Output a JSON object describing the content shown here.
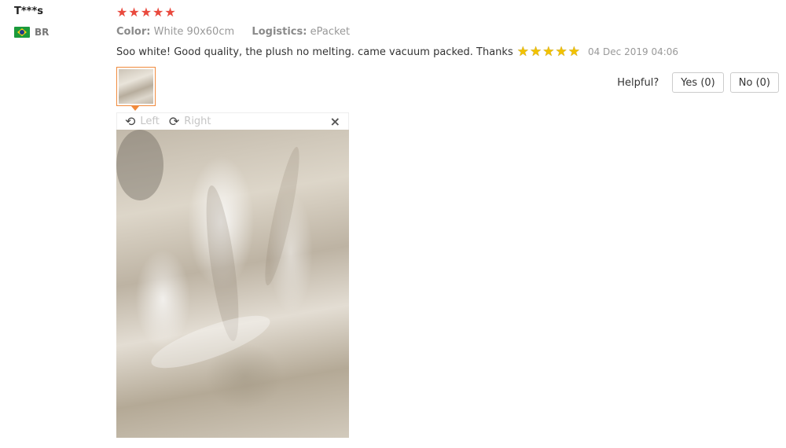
{
  "reviewer": {
    "name": "T***s",
    "country_code": "BR",
    "flag_icon": "brazil-flag-icon"
  },
  "rating": {
    "stars": 5,
    "max": 5,
    "color": "#e94a3e"
  },
  "attributes": {
    "color_label": "Color:",
    "color_value": "White 90x60cm",
    "logistics_label": "Logistics:",
    "logistics_value": "ePacket"
  },
  "feedback": {
    "text": "Soo white! Good quality, the plush no melting. came vacuum packed. Thanks",
    "emoji_star_count": 5,
    "date": "04 Dec 2019 04:06"
  },
  "helpful": {
    "label": "Helpful?",
    "yes_label": "Yes (0)",
    "no_label": "No (0)"
  },
  "viewer": {
    "rotate_left_label": "Left",
    "rotate_right_label": "Right",
    "close_icon": "×"
  },
  "colors": {
    "accent_orange": "#f08a3c",
    "star_yellow": "#f2c200"
  }
}
